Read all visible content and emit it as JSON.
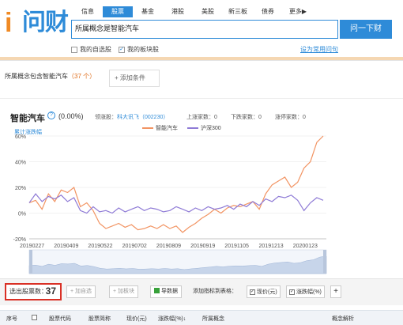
{
  "brand": {
    "logo_text": "问财"
  },
  "nav": {
    "tabs": [
      "信息",
      "股票",
      "基金",
      "港股",
      "美股",
      "新三板",
      "债券",
      "更多▶"
    ],
    "active_index": 1
  },
  "search": {
    "query": "所属概念是智能汽车",
    "button": "问一下财"
  },
  "options": {
    "my_watchlist": "我的自选股",
    "my_sectors": "我的板块股",
    "set_common": "设为常用问句"
  },
  "query_tab": {
    "label": "所属概念包含智能汽车",
    "count": "（37 个）",
    "add_condition": "添加条件"
  },
  "chart": {
    "title": "智能汽车",
    "help": "?",
    "pct": "(0.00%)",
    "leader_label": "领涨股：",
    "leader_value": "科大讯飞（002230）",
    "up_label": "上涨家数：",
    "up_value": "0",
    "down_label": "下跌家数：",
    "down_value": "0",
    "flat_label": "涨停家数：",
    "flat_value": "0",
    "cumul_label": "累计涨跌幅"
  },
  "chart_data": {
    "type": "line",
    "x_ticks": [
      "20190227",
      "20190409",
      "20190522",
      "20190702",
      "20190809",
      "20190919",
      "20191105",
      "20191213",
      "20200123"
    ],
    "y_ticks": [
      "60%",
      "40%",
      "20%",
      "0%",
      "-20%"
    ],
    "ylim": [
      -20,
      60
    ],
    "series": [
      {
        "name": "智能汽车",
        "color": "#f29463",
        "values": [
          8,
          10,
          3,
          15,
          9,
          18,
          16,
          20,
          5,
          8,
          2,
          -8,
          -12,
          -10,
          -8,
          -11,
          -9,
          -13,
          -12,
          -10,
          -12,
          -9,
          -12,
          -10,
          -15,
          -11,
          -8,
          -4,
          -1,
          3,
          0,
          4,
          6,
          5,
          7,
          9,
          3,
          15,
          22,
          25,
          28,
          20,
          24,
          35,
          40,
          55,
          60
        ]
      },
      {
        "name": "沪深300",
        "color": "#8f7bd6",
        "values": [
          8,
          15,
          9,
          13,
          11,
          14,
          9,
          12,
          2,
          0,
          5,
          1,
          2,
          0,
          4,
          1,
          3,
          5,
          2,
          4,
          3,
          1,
          2,
          5,
          3,
          1,
          4,
          2,
          5,
          3,
          4,
          6,
          3,
          7,
          5,
          9,
          6,
          11,
          9,
          13,
          12,
          14,
          10,
          2,
          8,
          12,
          10
        ]
      }
    ]
  },
  "toolbar": {
    "selected_label": "选出股票数：",
    "selected_count": "37",
    "add_watch": "+ 加自选",
    "add_sector": "+ 加板块",
    "export": "导数据",
    "add_indicator": "添加指标到表格：",
    "chk_price": "现价(元)",
    "chk_change": "涨跌幅(%)",
    "plus": "+"
  },
  "table": {
    "headers": [
      "序号",
      "股票代码",
      "股票简称",
      "现价(元)",
      "涨跌幅(%)↓",
      "所属概念",
      "概念解析"
    ]
  }
}
